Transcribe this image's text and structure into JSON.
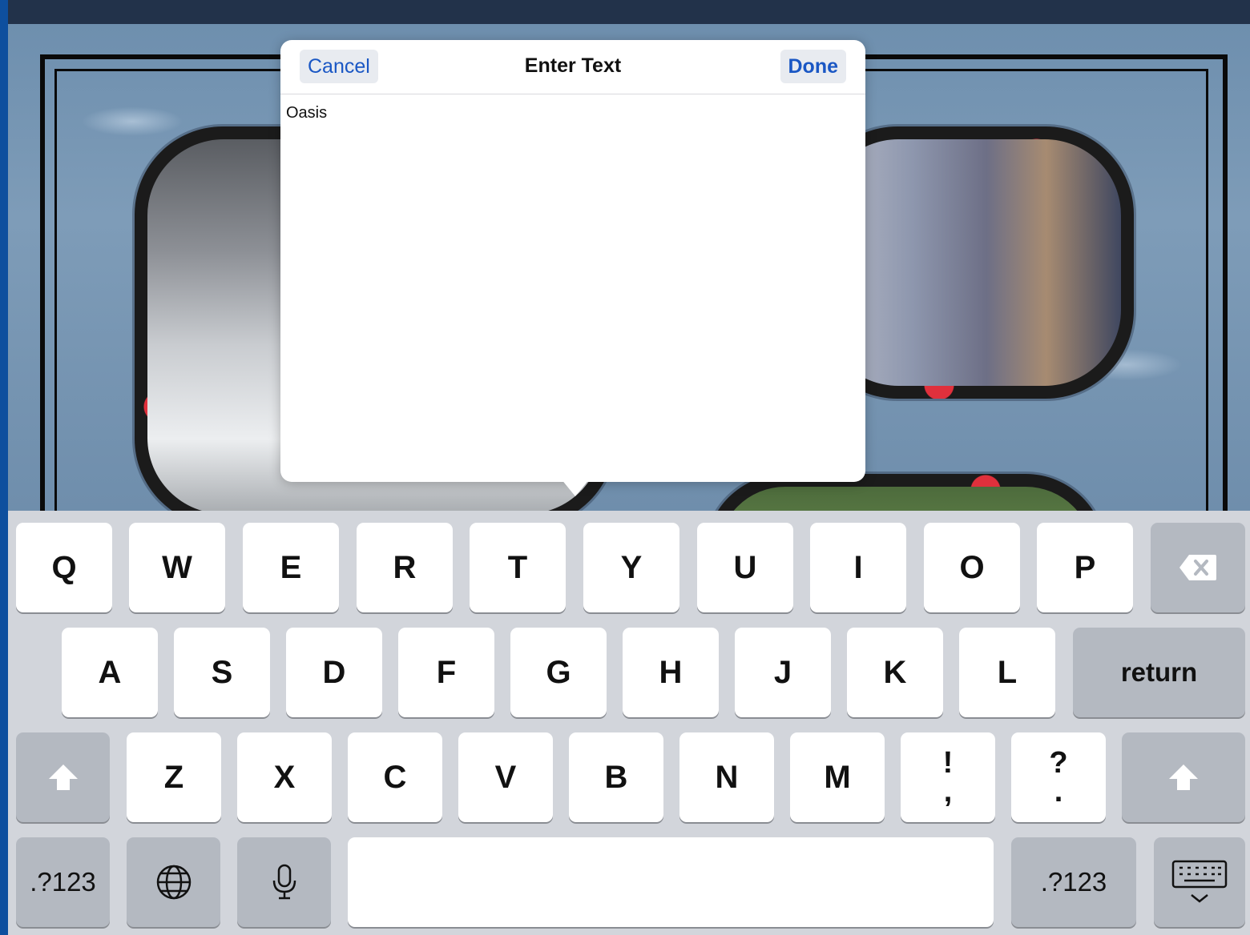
{
  "popover": {
    "title": "Enter Text",
    "cancel_label": "Cancel",
    "done_label": "Done",
    "text_value": "Oasis"
  },
  "keyboard": {
    "row1": [
      "Q",
      "W",
      "E",
      "R",
      "T",
      "Y",
      "U",
      "I",
      "O",
      "P"
    ],
    "row2": [
      "A",
      "S",
      "D",
      "F",
      "G",
      "H",
      "J",
      "K",
      "L"
    ],
    "row3": [
      "Z",
      "X",
      "C",
      "V",
      "B",
      "N",
      "M"
    ],
    "return_label": "return",
    "punct1_top": "!",
    "punct1_bottom": ",",
    "punct2_top": "?",
    "punct2_bottom": ".",
    "numbers_label_left": ".?123",
    "numbers_label_right": ".?123"
  },
  "icons": {
    "backspace": "backspace-icon",
    "shift": "shift-icon",
    "globe": "globe-icon",
    "microphone": "microphone-icon",
    "dismiss_keyboard": "keyboard-dismiss-icon"
  },
  "colors": {
    "accent": "#1a57c4",
    "keyboard_bg": "#d2d5db",
    "key_bg": "#ffffff",
    "fn_key_bg": "#b4b9c1",
    "canvas_border": "#0e4f9e"
  }
}
